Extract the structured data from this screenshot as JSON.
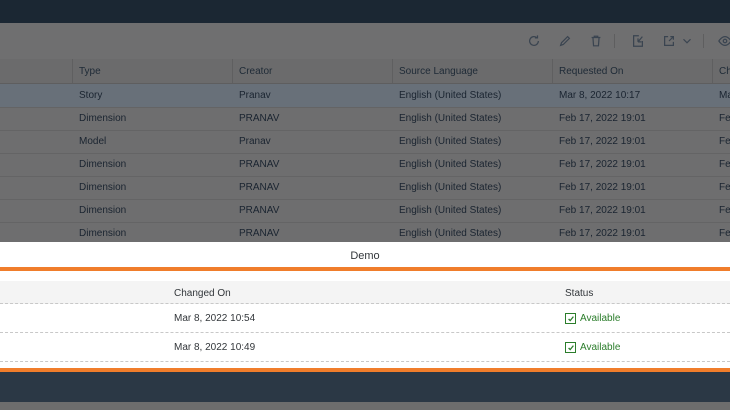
{
  "toolbar": {
    "icons": [
      "refresh-icon",
      "edit-icon",
      "delete-icon",
      "import-icon",
      "export-icon",
      "view-icon"
    ]
  },
  "grid": {
    "columns": [
      "Type",
      "Creator",
      "Source Language",
      "Requested On",
      "Ch"
    ],
    "rows": [
      {
        "type": "Story",
        "creator": "Pranav",
        "language": "English (United States)",
        "requested": "Mar 8, 2022 10:17",
        "ch": "Ma"
      },
      {
        "type": "Dimension",
        "creator": "PRANAV",
        "language": "English (United States)",
        "requested": "Feb 17, 2022 19:01",
        "ch": "Feb"
      },
      {
        "type": "Model",
        "creator": "Pranav",
        "language": "English (United States)",
        "requested": "Feb 17, 2022 19:01",
        "ch": "Feb"
      },
      {
        "type": "Dimension",
        "creator": "PRANAV",
        "language": "English (United States)",
        "requested": "Feb 17, 2022 19:01",
        "ch": "Feb"
      },
      {
        "type": "Dimension",
        "creator": "PRANAV",
        "language": "English (United States)",
        "requested": "Feb 17, 2022 19:01",
        "ch": "Feb"
      },
      {
        "type": "Dimension",
        "creator": "PRANAV",
        "language": "English (United States)",
        "requested": "Feb 17, 2022 19:01",
        "ch": "Feb"
      },
      {
        "type": "Dimension",
        "creator": "PRANAV",
        "language": "English (United States)",
        "requested": "Feb 17, 2022 19:01",
        "ch": "Feb"
      }
    ]
  },
  "demo": {
    "title": "Demo",
    "columns": [
      "Changed On",
      "Status"
    ],
    "rows": [
      {
        "changed": "Mar 8, 2022 10:54",
        "status": "Available"
      },
      {
        "changed": "Mar 8, 2022 10:49",
        "status": "Available"
      }
    ],
    "status_color": "#2b7d2b"
  },
  "colors": {
    "accent_orange": "#f07d2b",
    "shell_dark": "#1b2733"
  }
}
